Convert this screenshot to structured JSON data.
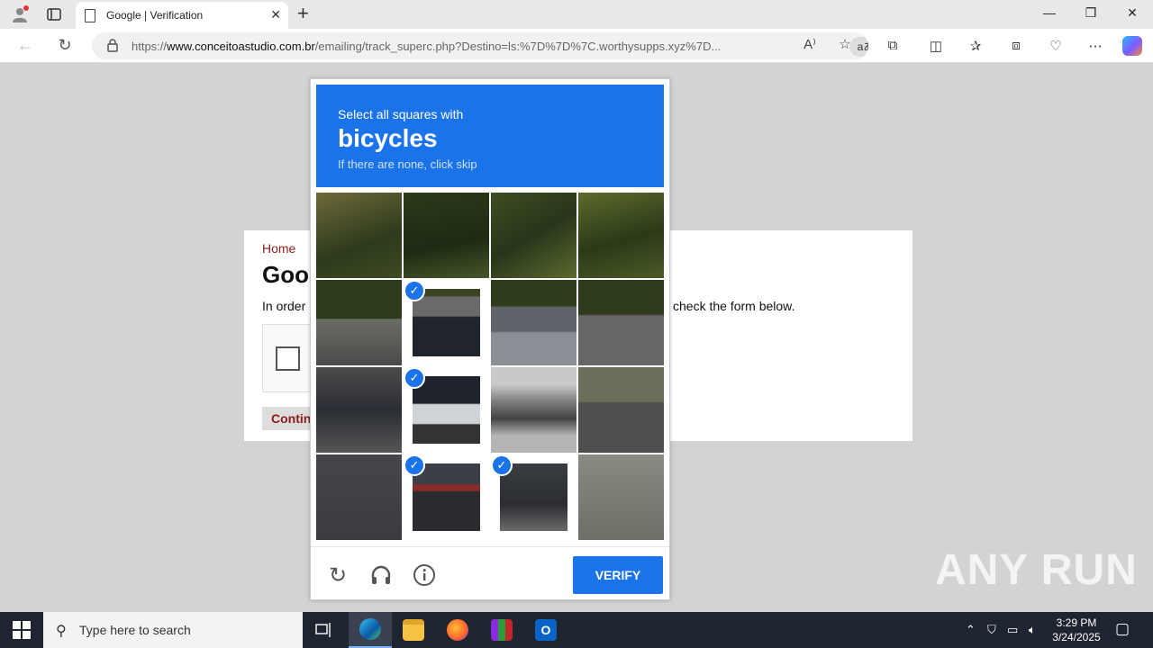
{
  "browser": {
    "tab_title": "Google | Verification",
    "url_prefix": "https://",
    "url_host": "www.conceitoastudio.com.br",
    "url_rest": "/emailing/track_superc.php?Destino=ls:%7D%7D%7C.worthysupps.xyz%7D...",
    "read_aloud_label": "aあ"
  },
  "page": {
    "home_link": "Home",
    "heading": "Goo",
    "order_text": "In order",
    "below_text": "check the form below.",
    "continue_label": "Contin"
  },
  "captcha": {
    "instruction": "Select all squares with",
    "target": "bicycles",
    "hint": "If there are none, click skip",
    "verify_label": "VERIFY",
    "selected_tiles": [
      5,
      9,
      13,
      14
    ]
  },
  "watermark": "ANY RUN",
  "taskbar": {
    "search_placeholder": "Type here to search",
    "time": "3:29 PM",
    "date": "3/24/2025"
  },
  "icons": {
    "profile": "profile-icon",
    "tabs": "tab-actions-icon",
    "back": "back-icon",
    "refresh": "refresh-icon",
    "lock": "lock-icon",
    "favorite": "star-icon",
    "extensions": "puzzle-icon",
    "split": "split-screen-icon",
    "favorites": "favorites-icon",
    "collections": "collections-icon",
    "performance": "heart-pulse-icon",
    "more": "more-icon",
    "reload": "reload-icon",
    "audio": "headphones-icon",
    "info": "info-icon"
  }
}
